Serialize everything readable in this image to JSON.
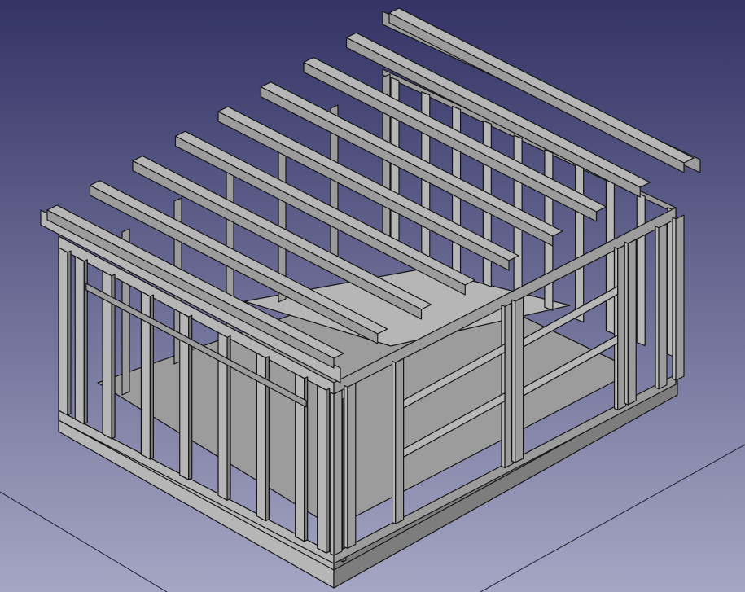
{
  "app": {
    "view": "3d-viewport"
  },
  "colors": {
    "background_top": "#333366",
    "background_bottom": "#a5a6c4",
    "model_face": "#9c9c9c",
    "model_face_light": "#b6b6b6",
    "model_face_dark": "#7d7d7d",
    "edge_line": "#141414",
    "ground_line": "#1c1c2a"
  },
  "model": {
    "type": "timber-frame-shed",
    "parts": [
      "foundation-frame",
      "floor",
      "wall-studs",
      "top-plates",
      "roof-rafters",
      "window-openings"
    ]
  }
}
